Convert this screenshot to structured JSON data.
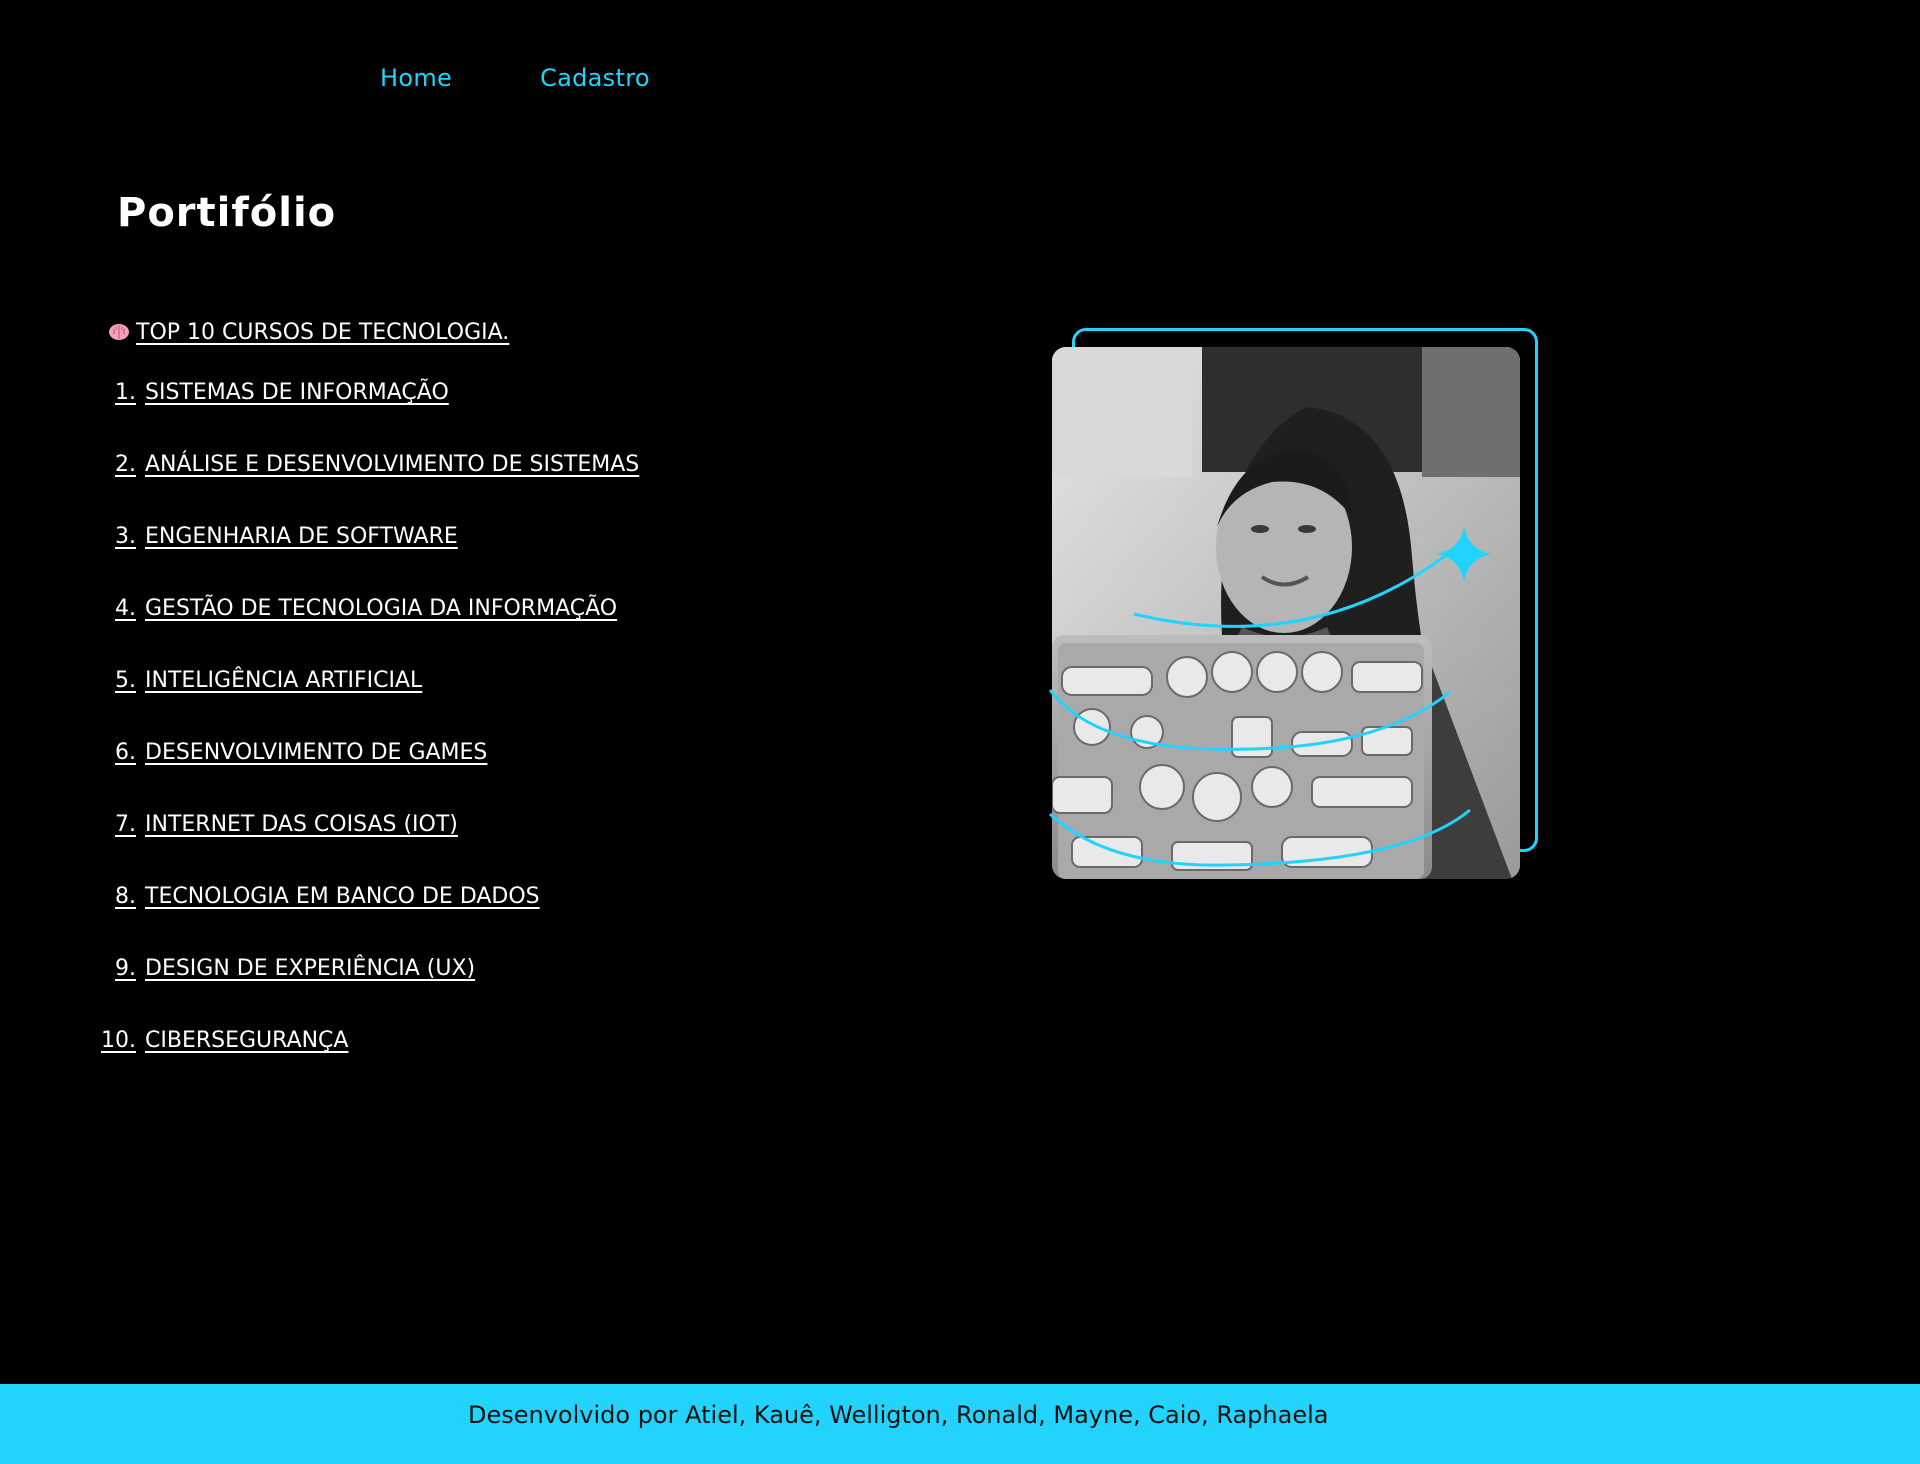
{
  "nav": {
    "items": [
      {
        "label": "Home"
      },
      {
        "label": "Cadastro"
      }
    ]
  },
  "page": {
    "title": "Portifólio"
  },
  "list": {
    "heading_icon": "brain-icon",
    "heading": "TOP 10 CURSOS DE TECNOLOGIA.",
    "items": [
      {
        "num": "1.",
        "name": "SISTEMAS DE INFORMAÇÃO"
      },
      {
        "num": "2.",
        "name": "ANÁLISE E DESENVOLVIMENTO DE SISTEMAS"
      },
      {
        "num": "3.",
        "name": "ENGENHARIA DE SOFTWARE"
      },
      {
        "num": "4.",
        "name": "GESTÃO DE TECNOLOGIA DA INFORMAÇÃO"
      },
      {
        "num": "5.",
        "name": "INTELIGÊNCIA ARTIFICIAL"
      },
      {
        "num": "6.",
        "name": "DESENVOLVIMENTO DE GAMES"
      },
      {
        "num": "7.",
        "name": "INTERNET DAS COISAS (IOT)"
      },
      {
        "num": "8.",
        "name": "TECNOLOGIA EM BANCO DE DADOS"
      },
      {
        "num": "9.",
        "name": "DESIGN DE EXPERIÊNCIA (UX)"
      },
      {
        "num": "10.",
        "name": "CIBERSEGURANÇA"
      }
    ]
  },
  "figure": {
    "image": "photo-woman-with-laptop",
    "decoration": "sparkle-icon"
  },
  "footer": {
    "text": "Desenvolvido por Atiel, Kauê, Welligton, Ronald, Mayne, Caio, Raphaela"
  },
  "colors": {
    "background": "#000000",
    "accent": "#22d4fd",
    "text": "#ffffff",
    "footer_text": "#111111"
  }
}
